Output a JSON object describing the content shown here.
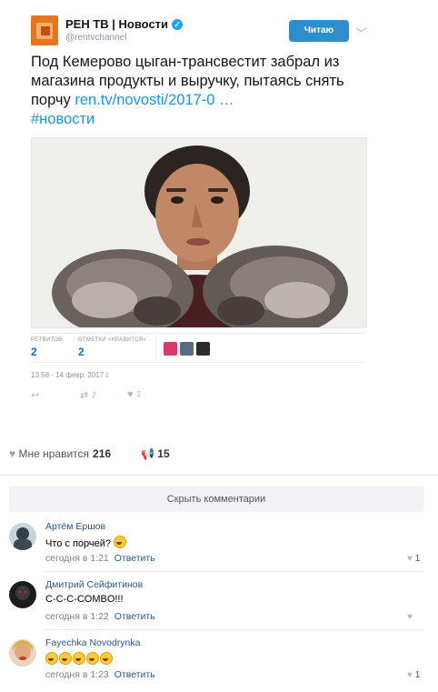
{
  "tweet": {
    "username": "РЕН ТВ | Новости",
    "verified_glyph": "✓",
    "handle": "@rentvchannel",
    "follow_label": "Читаю",
    "menu_icon": "chevron-down-icon",
    "text": "Под Кемерово цыган-трансвестит забрал из магазина продукты и выручку, пытаясь снять порчу ",
    "link": "ren.tv/novosti/2017-0 …",
    "hashtag": "#новости",
    "retweets_label": "РЕТВИТОВ",
    "retweets": "2",
    "likes_label": "ОТМЕТКИ «НРАВИТСЯ»",
    "likes": "2",
    "timestamp": "13:58 - 14 февр. 2017 г.",
    "actions": {
      "reply_icon": "↩",
      "retweet_icon": "⇄",
      "retweet_count": "2",
      "like_icon": "♥",
      "like_count": "2"
    }
  },
  "post": {
    "likes_label": "Мне нравится",
    "likes_count": "216",
    "shares_count": "15"
  },
  "hide_comments_label": "Скрыть комментарии",
  "comments": [
    {
      "author": "Артём Ершов",
      "text": "Что с порчей?",
      "time": "сегодня в 1:21",
      "reply": "Ответить",
      "likes": "1"
    },
    {
      "author": "Дмитрий Сейфитинов",
      "text": "С-С-С-COMBO!!!",
      "time": "сегодня в 1:22",
      "reply": "Ответить",
      "likes": ""
    },
    {
      "author": "Fayechka Novodrynka",
      "text": "",
      "time": "сегодня в 1:23",
      "reply": "Ответить",
      "likes": "1"
    }
  ],
  "colors": {
    "twitter_blue": "#1b95e0",
    "follow_button": "#2d8ecb",
    "vk_link": "#2a5885",
    "rentv_orange": "#e8741e"
  }
}
